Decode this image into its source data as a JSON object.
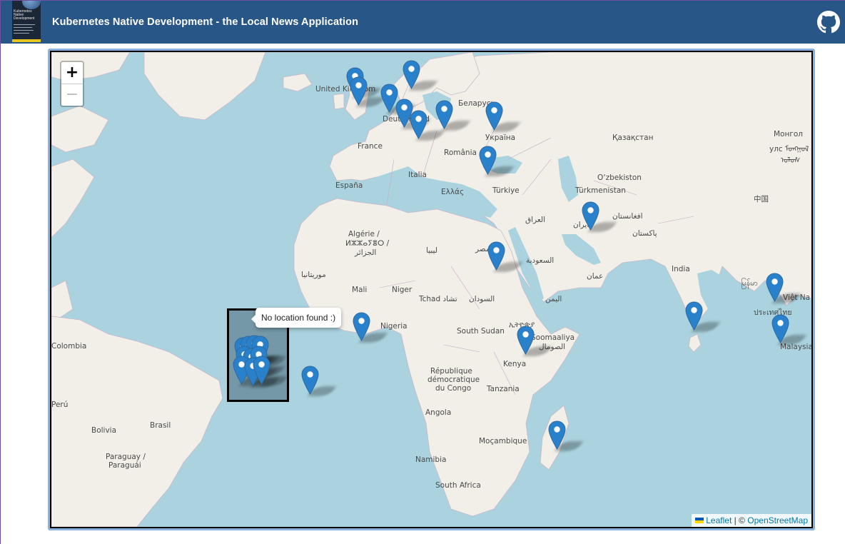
{
  "header": {
    "title": "Kubernetes Native Development - the Local News Application",
    "book_cover_text": "Kubernetes Native Development",
    "github_icon": "github-icon",
    "bg_color": "#285687"
  },
  "map": {
    "zoom_in_label": "+",
    "zoom_out_label": "−",
    "popup_text": "No location found :)",
    "attribution": {
      "leaflet": "Leaflet",
      "separator": "|",
      "copyright": "©",
      "osm": "OpenStreetMap"
    },
    "water_color": "#aad3df",
    "land_color": "#f2efe9",
    "marker_color": "#2a81cb",
    "labels": {
      "united_kingdom": "United Kingdom",
      "belarus": "Беларусь",
      "deutschland": "Deutschland",
      "ukraine": "Україна",
      "kazakhstan": "Қазақстан",
      "mongolia_1": "Монгол",
      "mongolia_2": "улс ᠮᠣᠩᠭᠣᠯ",
      "mongolia_3": "ᠤᠯᠤᠰ",
      "france": "France",
      "romania": "România",
      "espana": "España",
      "italia": "Italia",
      "ellada": "Ελλάς",
      "turkiye": "Türkiye",
      "uzbekistan": "O‘zbekiston",
      "turkmenistan": "Türkmenistan",
      "china": "中国",
      "iraq": "العراق",
      "afghanistan": "افغانستان",
      "iran": "ایران",
      "pakistan": "پاکستان",
      "algerie_1": "Algérie /",
      "algerie_2": "ⵍⵣⵣⴰⵢⴻⵔ /",
      "algerie_3": "الجزائر",
      "libya": "ليبيا",
      "egypt": "مصر",
      "saudi": "السعودية",
      "oman": "عمان",
      "india": "India",
      "myanmar": "မြန်မာ",
      "viet_nam": "Việt Na",
      "mauritania": "موريتانيا",
      "mali": "Mali",
      "niger": "Niger",
      "tchad": "Tchad تشاد",
      "sudan": "السودان",
      "yemen": "اليمن",
      "thailand": "ประเทศไทย",
      "nigeria": "Nigeria",
      "south_sudan": "South Sudan",
      "ethiopia": "ኢትዮጵያ",
      "somalia_1": "Soomaaliya",
      "somalia_2": "الصومال",
      "malaysia": "Malaysia",
      "colombia": "Colombia",
      "kenya": "Kenya",
      "drc_1": "République",
      "drc_2": "démocratique",
      "drc_3": "du Congo",
      "tanzania": "Tanzania",
      "peru": "Perú",
      "angola": "Angola",
      "bolivia": "Bolivia",
      "brasil": "Brasil",
      "mocambique": "Moçambique",
      "paraguay_1": "Paraguay /",
      "paraguay_2": "Paraguái",
      "namibia": "Namibia",
      "south_africa": "South Africa"
    }
  }
}
